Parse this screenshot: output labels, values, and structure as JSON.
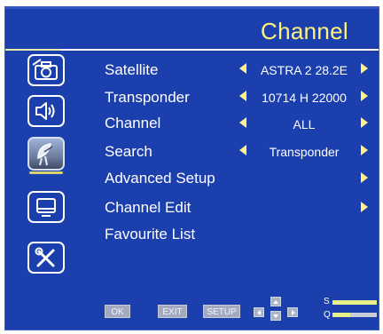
{
  "header": {
    "title": "Channel"
  },
  "sidebar": {
    "icons": [
      {
        "name": "camera-icon",
        "selected": false
      },
      {
        "name": "speaker-icon",
        "selected": false
      },
      {
        "name": "satellite-dish-icon",
        "selected": true
      },
      {
        "name": "monitor-icon",
        "selected": false
      },
      {
        "name": "tools-icon",
        "selected": false
      }
    ]
  },
  "menu": {
    "items": [
      {
        "label": "Satellite",
        "value": "ASTRA 2 28.2E",
        "has_left": true,
        "has_right": true
      },
      {
        "label": "Transponder",
        "value": "10714 H 22000",
        "has_left": true,
        "has_right": true
      },
      {
        "label": "Channel",
        "value": "ALL",
        "has_left": true,
        "has_right": true
      },
      {
        "label": "Search",
        "value": "Transponder",
        "has_left": true,
        "has_right": true
      },
      {
        "label": "Advanced Setup",
        "value": "",
        "has_left": false,
        "has_right": true
      },
      {
        "label": "Channel Edit",
        "value": "",
        "has_left": false,
        "has_right": true
      },
      {
        "label": "Favourite List",
        "value": "",
        "has_left": false,
        "has_right": false
      }
    ]
  },
  "footer": {
    "ok_label": "OK",
    "exit_label": "EXIT",
    "setup_label": "SETUP",
    "signal": {
      "s_label": "S",
      "q_label": "Q",
      "strength": 1.0,
      "quality": 0.4
    }
  },
  "colors": {
    "background": "#1c3fae",
    "title": "#fff37a",
    "arrow": "#fff28a",
    "bar_fill": "#e8f08a"
  }
}
